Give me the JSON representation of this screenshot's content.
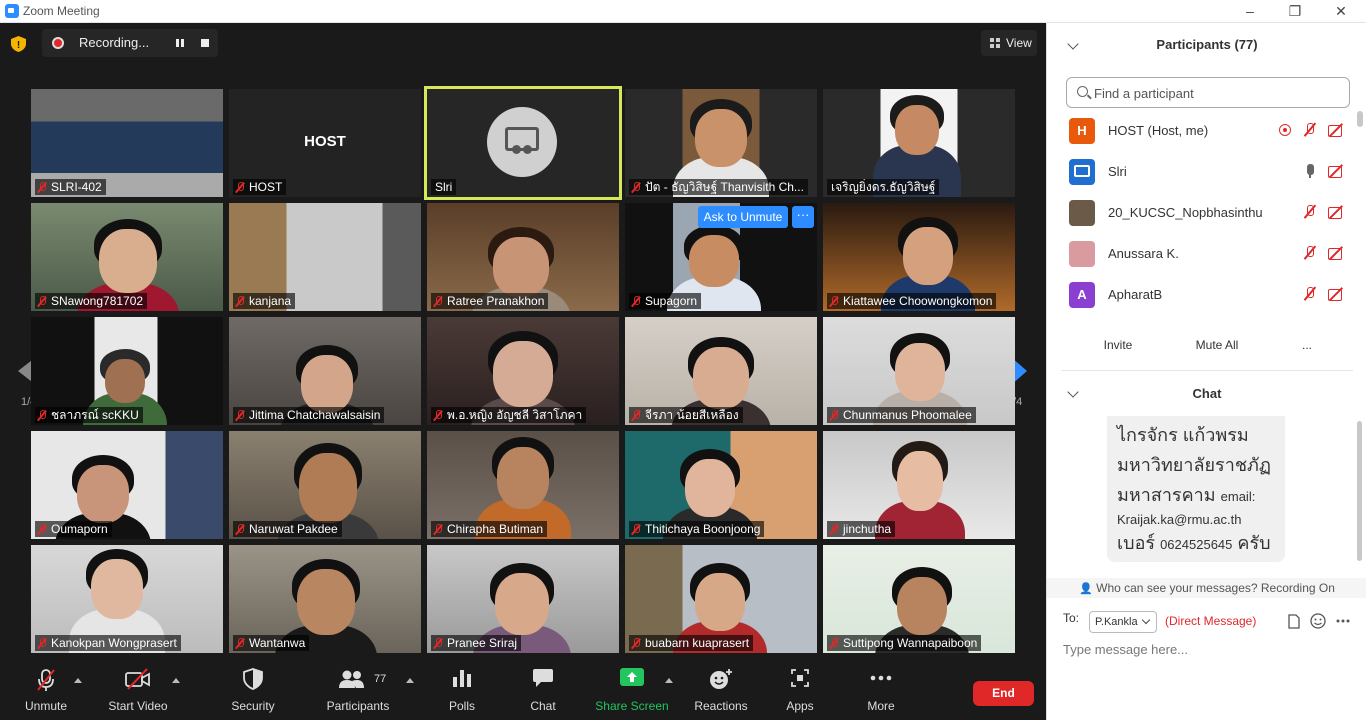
{
  "window": {
    "title": "Zoom Meeting"
  },
  "recording": {
    "label": "Recording..."
  },
  "view_button": {
    "label": "View"
  },
  "gallery": {
    "page_left": "1/4",
    "page_right": "1/4",
    "tiles": [
      {
        "name": "SLRI-402",
        "muted": true
      },
      {
        "name": "HOST",
        "muted": true,
        "host_text": "HOST"
      },
      {
        "name": "Slri",
        "muted": false
      },
      {
        "name": "ปัต - ธัญวิสิษฐ์ Thanvisith Ch...",
        "muted": true
      },
      {
        "name": "เจริญยิ่งดร.ธัญวิสิษฐ์",
        "muted": false
      },
      {
        "name": "SNawong781702",
        "muted": true
      },
      {
        "name": "kanjana",
        "muted": true
      },
      {
        "name": "Ratree Pranakhon",
        "muted": true
      },
      {
        "name": "Supagorn",
        "muted": true
      },
      {
        "name": "Kiattawee Choowongkomon",
        "muted": true
      },
      {
        "name": "ชลาภรณ์ scKKU",
        "muted": true
      },
      {
        "name": "Jittima Chatchawalsaisin",
        "muted": true
      },
      {
        "name": "พ.อ.หญิง อัญชลี วิสาโภคา",
        "muted": true
      },
      {
        "name": "จีรภา น้อยสีเหลือง",
        "muted": true
      },
      {
        "name": "Chunmanus Phoomalee",
        "muted": true
      },
      {
        "name": "Oumaporn",
        "muted": true
      },
      {
        "name": "Naruwat Pakdee",
        "muted": true
      },
      {
        "name": "Chirapha Butiman",
        "muted": true
      },
      {
        "name": "Thitichaya Boonjoong",
        "muted": true
      },
      {
        "name": "jinchutha",
        "muted": true
      },
      {
        "name": "Kanokpan Wongprasert",
        "muted": true
      },
      {
        "name": "Wantanwa",
        "muted": true
      },
      {
        "name": "Pranee Sriraj",
        "muted": true
      },
      {
        "name": "buabarn kuaprasert",
        "muted": true
      },
      {
        "name": "Suttipong Wannapaiboon",
        "muted": true
      }
    ],
    "ask_unmute": "Ask to Unmute",
    "more": "···"
  },
  "toolbar": {
    "unmute": "Unmute",
    "start_video": "Start Video",
    "security": "Security",
    "participants": "Participants",
    "participants_count": "77",
    "polls": "Polls",
    "chat": "Chat",
    "share_screen": "Share Screen",
    "reactions": "Reactions",
    "apps": "Apps",
    "more": "More",
    "end": "End"
  },
  "participants_panel": {
    "title": "Participants (77)",
    "search_placeholder": "Find a participant",
    "list": [
      {
        "name": "HOST (Host, me)",
        "avatar": "H",
        "avatar_color": "#e8590c"
      },
      {
        "name": "Slri",
        "avatar": "",
        "avatar_color": "#1e6fd0"
      },
      {
        "name": "20_KUCSC_Nopbhasinthu",
        "avatar": "",
        "avatar_color": "#6b5a48"
      },
      {
        "name": "Anussara K.",
        "avatar": "",
        "avatar_color": "#d99aa0"
      },
      {
        "name": "ApharatB",
        "avatar": "A",
        "avatar_color": "#8a3fd1"
      }
    ],
    "invite": "Invite",
    "mute_all": "Mute All",
    "more": "..."
  },
  "chat_panel": {
    "title": "Chat",
    "message_lines": [
      "ไกรจักร แก้วพรม",
      "มหาวิทยาลัยราชภัฏ",
      "มหาสารคาม",
      "email:",
      "Kraijak.ka@rmu.ac.th",
      "เบอร์",
      "0624525645",
      "ครับ"
    ],
    "who_can_see": "Who can see your messages? Recording On",
    "to_label": "To:",
    "to_value": "P.Kankla",
    "direct_message": "(Direct Message)",
    "type_placeholder": "Type message here..."
  }
}
